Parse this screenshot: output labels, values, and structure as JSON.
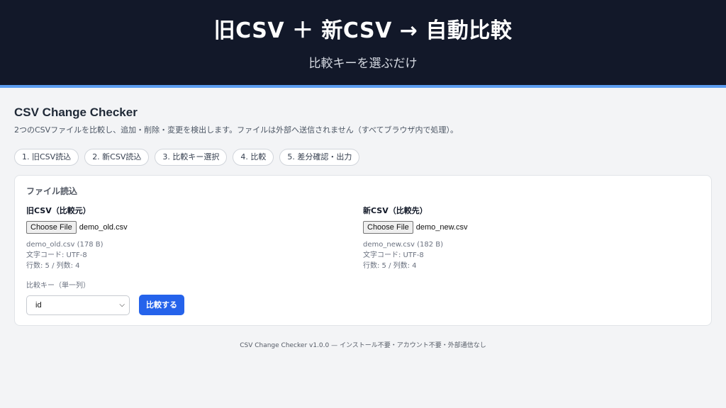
{
  "hero": {
    "title": "旧CSV ＋ 新CSV → 自動比較",
    "subtitle": "比較キーを選ぶだけ"
  },
  "app": {
    "title": "CSV Change Checker",
    "description": "2つのCSVファイルを比較し、追加・削除・変更を検出します。ファイルは外部へ送信されません（すべてブラウザ内で処理）。"
  },
  "steps": [
    "1. 旧CSV読込",
    "2. 新CSV読込",
    "3. 比較キー選択",
    "4. 比較",
    "5. 差分確認・出力"
  ],
  "card": {
    "title": "ファイル読込",
    "old": {
      "label": "旧CSV（比較元）",
      "button": "Choose File",
      "filename": "demo_old.csv",
      "info": "demo_old.csv (178 B)",
      "encoding": "文字コード: UTF-8",
      "counts": "行数: 5 / 列数: 4"
    },
    "new": {
      "label": "新CSV（比較先）",
      "button": "Choose File",
      "filename": "demo_new.csv",
      "info": "demo_new.csv (182 B)",
      "encoding": "文字コード: UTF-8",
      "counts": "行数: 5 / 列数: 4"
    },
    "key_label": "比較キー（単一列）",
    "key_selected": "id",
    "compare_button": "比較する"
  },
  "footer": "CSV Change Checker v1.0.0 — インストール不要・アカウント不要・外部通信なし"
}
